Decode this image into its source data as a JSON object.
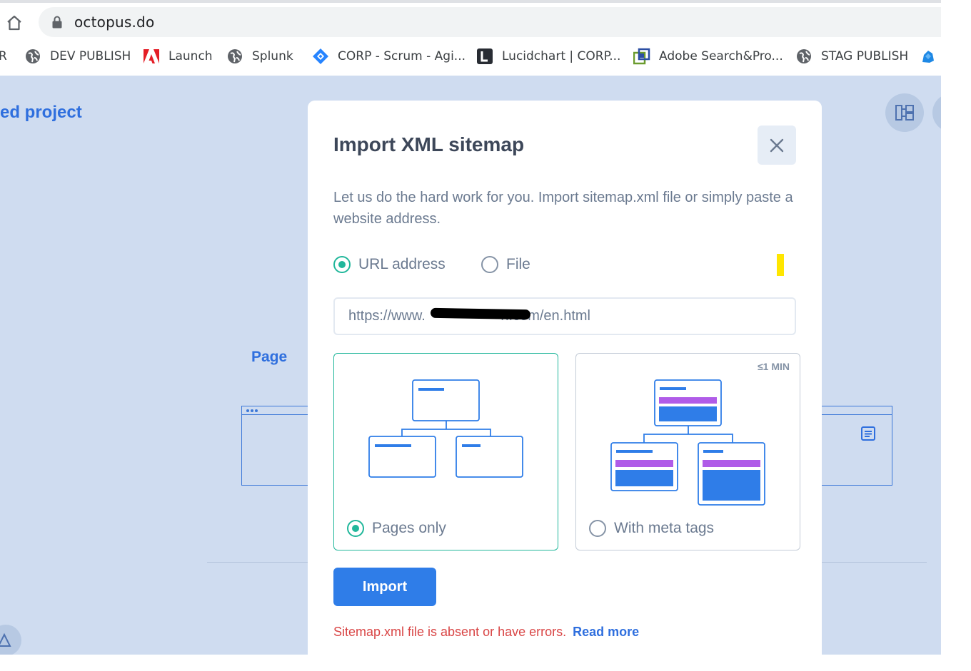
{
  "browser": {
    "url": "octopus.do",
    "bookmarks": [
      {
        "label": "R",
        "icon": "globe-icon"
      },
      {
        "label": "DEV PUBLISH",
        "icon": "globe-icon"
      },
      {
        "label": "Launch",
        "icon": "adobe-icon"
      },
      {
        "label": "Splunk",
        "icon": "globe-icon"
      },
      {
        "label": "CORP - Scrum - Agi...",
        "icon": "jira-icon"
      },
      {
        "label": "Lucidchart | CORP...",
        "icon": "lucidchart-icon"
      },
      {
        "label": "Adobe Search&Pro...",
        "icon": "adobe-search-icon"
      },
      {
        "label": "STAG PUBLISH",
        "icon": "globe-icon"
      },
      {
        "label": "",
        "icon": "extension-icon"
      }
    ]
  },
  "app": {
    "project_title": "ed project",
    "page_card_label": "Page"
  },
  "modal": {
    "title": "Import XML sitemap",
    "description": "Let us do the hard work for you. Import sitemap.xml file or simply paste a website address.",
    "source_options": [
      {
        "label": "URL address",
        "selected": true
      },
      {
        "label": "File",
        "selected": false
      }
    ],
    "url_value": "https://www.                   h.com/en.html",
    "url_prefix": "https://www.",
    "url_suffix": "h.com/en.html",
    "import_modes": [
      {
        "label": "Pages only",
        "selected": true,
        "badge": ""
      },
      {
        "label": "With meta tags",
        "selected": false,
        "badge": "≤1 MIN"
      }
    ],
    "import_button": "Import",
    "error_text": "Sitemap.xml file is absent or have errors.",
    "read_more": "Read more"
  },
  "colors": {
    "accent_blue": "#2f7de8",
    "accent_green": "#21b79b",
    "error_red": "#d94545",
    "purple": "#b05ce8",
    "app_bg": "#cfdcf0"
  }
}
